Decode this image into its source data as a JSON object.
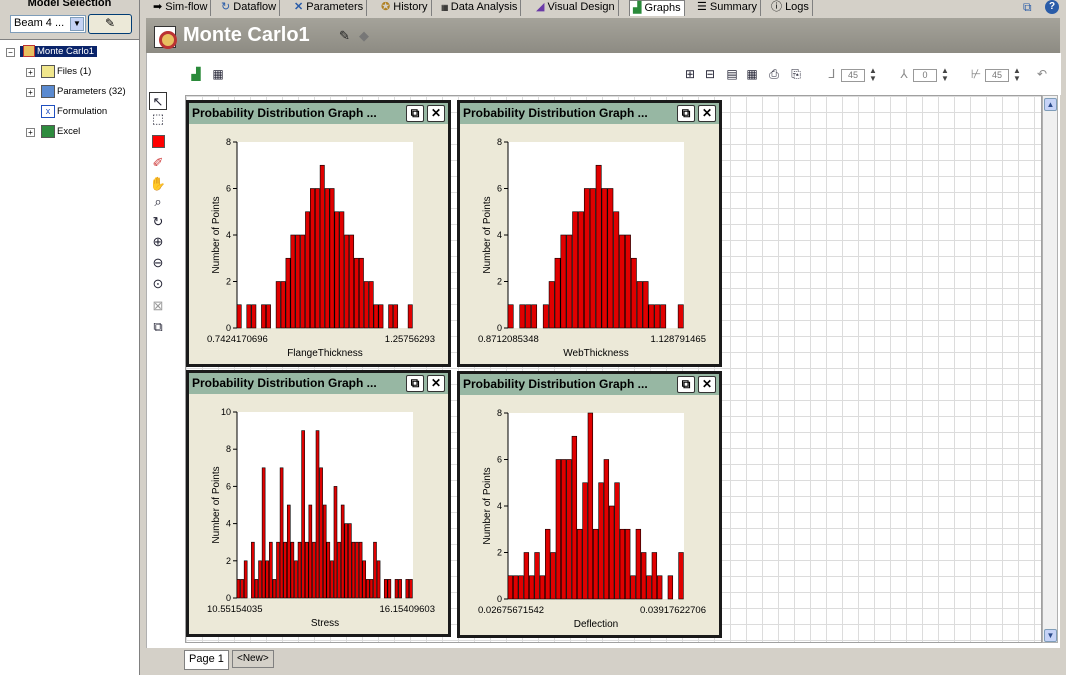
{
  "model_selection": {
    "title": "Model Selection",
    "selected": "Beam 4 ...",
    "edit_icon": "edit-notes-icon"
  },
  "tree": {
    "root": "Monte Carlo1",
    "items": [
      {
        "label": "Files (1)",
        "icon": "files-icon",
        "expandable": true
      },
      {
        "label": "Parameters (32)",
        "icon": "parameters-icon",
        "expandable": true
      },
      {
        "label": "Formulation",
        "icon": "formulation-icon",
        "expandable": false
      },
      {
        "label": "Excel",
        "icon": "excel-icon",
        "expandable": true
      }
    ]
  },
  "tabs": [
    {
      "label": "Sim-flow",
      "icon": "arrow-right-icon"
    },
    {
      "label": "Dataflow",
      "icon": "dataflow-icon"
    },
    {
      "label": "Parameters",
      "icon": "parameters-icon"
    },
    {
      "label": "History",
      "icon": "history-icon"
    },
    {
      "label": "Data Analysis",
      "icon": "data-analysis-icon"
    },
    {
      "label": "Visual Design",
      "icon": "visual-design-icon"
    },
    {
      "label": "Graphs",
      "icon": "graphs-icon",
      "active": true
    },
    {
      "label": "Summary",
      "icon": "summary-icon"
    },
    {
      "label": "Logs",
      "icon": "info-icon"
    }
  ],
  "window_title": "Monte Carlo1",
  "toolbar": {
    "spin_values": [
      "45",
      "0",
      "45"
    ]
  },
  "graphs": [
    {
      "title": "Probability Distribution Graph ...",
      "chart_data": {
        "type": "bar",
        "xlabel": "FlangeThickness",
        "ylabel": "Number of Points",
        "x_min_label": "0.7424170696",
        "x_max_label": "1.25756293",
        "ylim": [
          0,
          8
        ],
        "yticks": [
          "0",
          "2",
          "4",
          "6",
          "8"
        ],
        "values": [
          1,
          0,
          1,
          1,
          0,
          1,
          1,
          0,
          2,
          2,
          3,
          4,
          4,
          4,
          5,
          6,
          6,
          7,
          6,
          6,
          5,
          5,
          4,
          4,
          3,
          3,
          2,
          2,
          1,
          1,
          0,
          1,
          1,
          0,
          0,
          1
        ]
      }
    },
    {
      "title": "Probability Distribution Graph ...",
      "chart_data": {
        "type": "bar",
        "xlabel": "WebThickness",
        "ylabel": "Number of Points",
        "x_min_label": "0.8712085348",
        "x_max_label": "1.128791465",
        "ylim": [
          0,
          8
        ],
        "yticks": [
          "0",
          "2",
          "4",
          "6",
          "8"
        ],
        "values": [
          1,
          0,
          1,
          1,
          1,
          0,
          1,
          2,
          3,
          4,
          4,
          5,
          5,
          6,
          6,
          7,
          6,
          6,
          5,
          4,
          4,
          3,
          2,
          2,
          1,
          1,
          1,
          0,
          0,
          1
        ]
      }
    },
    {
      "title": "Probability Distribution Graph ...",
      "chart_data": {
        "type": "bar",
        "xlabel": "Stress",
        "ylabel": "Number of Points",
        "x_min_label": "10.55154035",
        "x_max_label": "16.15409603",
        "ylim": [
          0,
          10
        ],
        "yticks": [
          "0",
          "2",
          "4",
          "6",
          "8",
          "10"
        ],
        "values": [
          1,
          1,
          2,
          0,
          3,
          1,
          2,
          7,
          2,
          3,
          1,
          3,
          7,
          3,
          5,
          3,
          2,
          3,
          9,
          3,
          5,
          3,
          9,
          7,
          5,
          3,
          2,
          6,
          3,
          5,
          4,
          4,
          3,
          3,
          3,
          2,
          1,
          1,
          3,
          2,
          0,
          1,
          1,
          0,
          1,
          1,
          0,
          1,
          1
        ]
      }
    },
    {
      "title": "Probability Distribution Graph ...",
      "chart_data": {
        "type": "bar",
        "xlabel": "Deflection",
        "ylabel": "Number of Points",
        "x_min_label": "0.02675671542",
        "x_max_label": "0.03917622706",
        "ylim": [
          0,
          8
        ],
        "yticks": [
          "0",
          "2",
          "4",
          "6",
          "8"
        ],
        "values": [
          1,
          1,
          1,
          2,
          1,
          2,
          1,
          3,
          2,
          6,
          6,
          6,
          7,
          3,
          5,
          8,
          3,
          5,
          6,
          4,
          5,
          3,
          3,
          1,
          3,
          2,
          1,
          2,
          1,
          0,
          1,
          0,
          2
        ]
      }
    }
  ],
  "page_tabs": [
    "Page 1",
    "<New>"
  ]
}
